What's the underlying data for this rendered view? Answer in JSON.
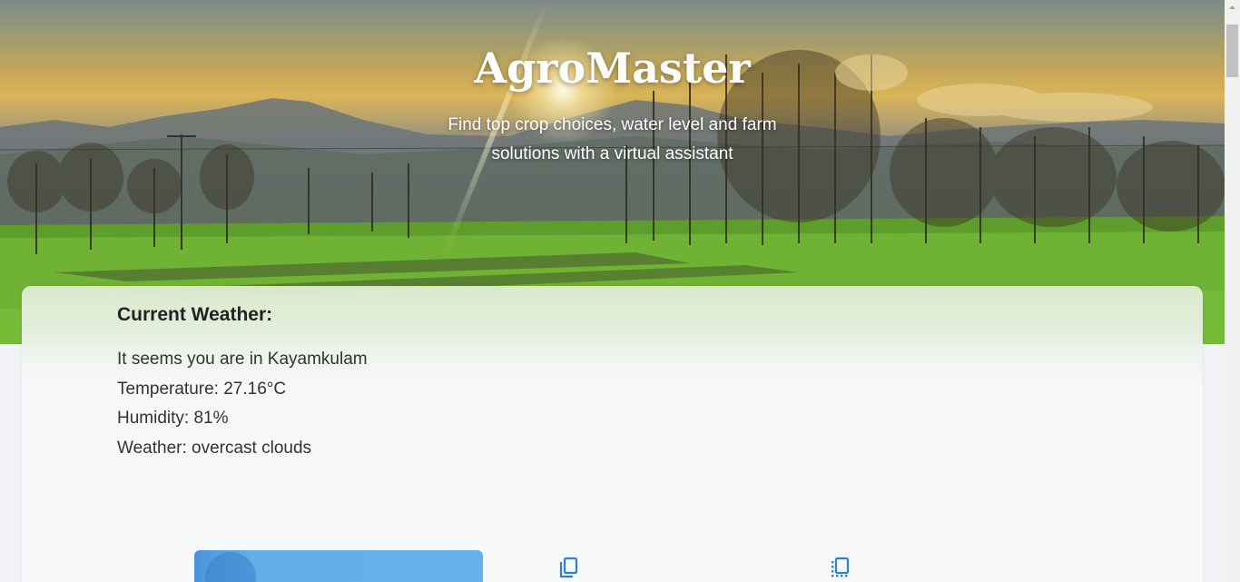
{
  "hero": {
    "title": "AgroMaster",
    "subtitle_line1": "Find top crop choices, water level and farm",
    "subtitle_line2": "solutions with a virtual assistant"
  },
  "weather": {
    "heading": "Current Weather:",
    "location": "It seems you are in Kayamkulam",
    "temperature": "Temperature: 27.16°C",
    "humidity": "Humidity: 81%",
    "condition": "Weather: overcast clouds"
  },
  "features": {
    "icons": [
      "copy-icon",
      "list-copy-icon"
    ]
  },
  "colors": {
    "accent": "#2f7fd6",
    "panel": "#62aee9",
    "card": "#f7f8fa"
  }
}
